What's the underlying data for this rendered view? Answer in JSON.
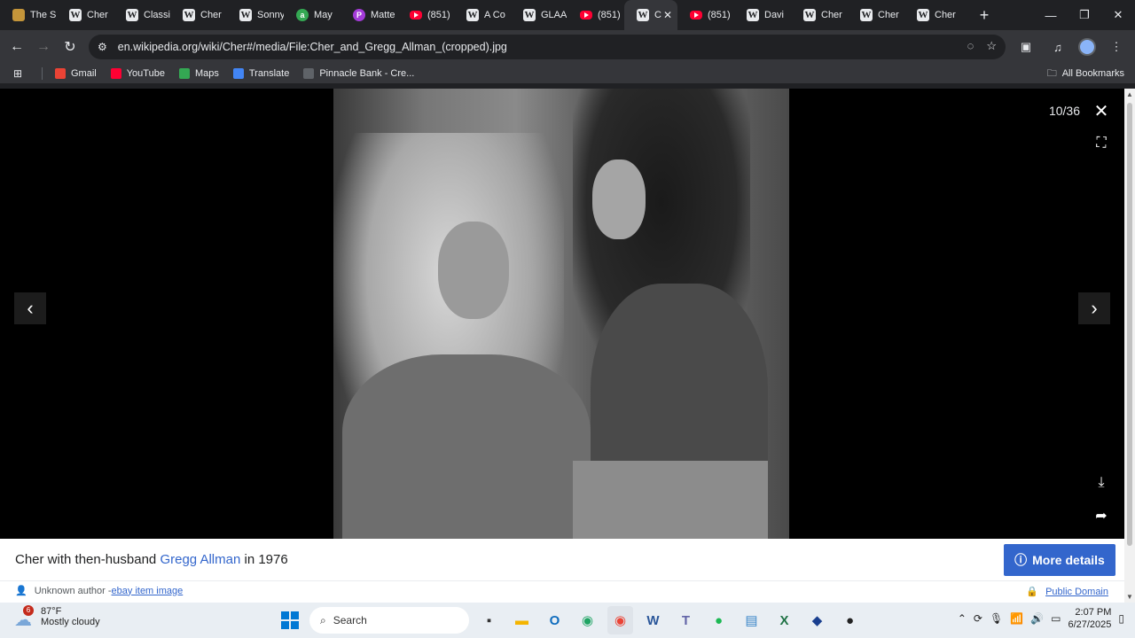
{
  "tabs": [
    {
      "label": "The S",
      "icon": "box-icon"
    },
    {
      "label": "Cher",
      "icon": "wikipedia-icon"
    },
    {
      "label": "Classi",
      "icon": "wikipedia-icon"
    },
    {
      "label": "Cher",
      "icon": "wikipedia-icon"
    },
    {
      "label": "Sonny",
      "icon": "wikipedia-icon"
    },
    {
      "label": "May",
      "icon": "green-a-icon"
    },
    {
      "label": "Matte",
      "icon": "patreon-icon"
    },
    {
      "label": "(851)",
      "icon": "youtube-icon"
    },
    {
      "label": "A Co",
      "icon": "wikipedia-icon"
    },
    {
      "label": "GLAA",
      "icon": "wikipedia-icon"
    },
    {
      "label": "(851)",
      "icon": "youtube-icon"
    },
    {
      "label": "C",
      "icon": "wikipedia-icon",
      "active": true
    },
    {
      "label": "(851)",
      "icon": "youtube-icon"
    },
    {
      "label": "Davi",
      "icon": "wikipedia-icon"
    },
    {
      "label": "Cher",
      "icon": "wikipedia-icon"
    },
    {
      "label": "Cher",
      "icon": "wikipedia-icon"
    },
    {
      "label": "Cher",
      "icon": "wikipedia-icon"
    }
  ],
  "address": {
    "url": "en.wikipedia.org/wiki/Cher#/media/File:Cher_and_Gregg_Allman_(cropped).jpg"
  },
  "bookmarks": {
    "items": [
      {
        "label": "Gmail",
        "icon": "gmail-icon",
        "color": "#ea4335"
      },
      {
        "label": "YouTube",
        "icon": "youtube-icon",
        "color": "#ff0033"
      },
      {
        "label": "Maps",
        "icon": "maps-icon",
        "color": "#34a853"
      },
      {
        "label": "Translate",
        "icon": "translate-icon",
        "color": "#4285f4"
      },
      {
        "label": "Pinnacle Bank - Cre...",
        "icon": "bank-icon",
        "color": "#5f6368"
      }
    ],
    "all_label": "All Bookmarks"
  },
  "viewer": {
    "counter": "10/36"
  },
  "caption": {
    "prefix": "Cher with then-husband",
    "link": "Gregg Allman",
    "suffix": "in 1976",
    "more_details": "More details"
  },
  "attribution": {
    "author": "Unknown author - ",
    "source_link": "ebay item image",
    "license": "Public Domain"
  },
  "taskbar": {
    "weather_badge": "6",
    "temperature": "87°F",
    "condition": "Mostly cloudy",
    "search_label": "Search",
    "time": "2:07 PM",
    "date": "6/27/2025"
  },
  "colors": {
    "accent": "#3366cc",
    "chrome_dark": "#202124",
    "toolbar": "#35363a"
  }
}
